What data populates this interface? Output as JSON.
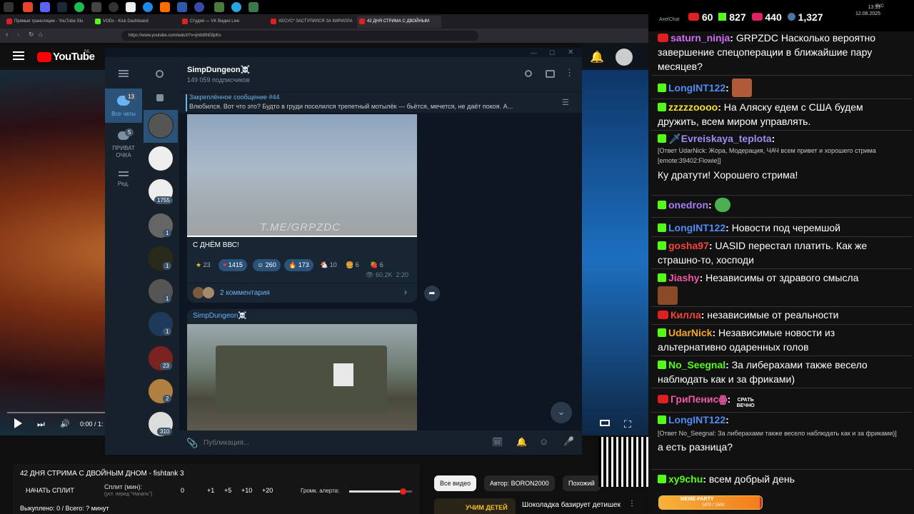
{
  "system": {
    "time": "13:39",
    "date": "12.08.2025",
    "lang": "РУС"
  },
  "browser": {
    "tabs": [
      {
        "label": "Прямые трансляции - YouTube Stu"
      },
      {
        "label": "VODs - Kick Dashboard"
      },
      {
        "label": "Студия — VK Видео Live"
      },
      {
        "label": "ХЕСУС* ЗАСТУПИЛСЯ ЗА КИРИЛЛА"
      },
      {
        "label": "42 ДНЯ СТРИМА С ДВОЙНЫМ"
      }
    ],
    "url": "https://www.youtube.com/watch?v=jmbt9hE8pKs"
  },
  "youtube": {
    "logo": "YouTube",
    "region": "NL",
    "time": "0:00 / 1:",
    "title": "42 ДНЯ СТРИМА С ДВОЙНЫМ ДНОМ - fishtank 3",
    "filter_all": "Все видео",
    "filter_author": "Автор: BORON2000",
    "filter_similar": "Похожий",
    "rec_title": "Шоколадка базирует детишек",
    "rec_thumb_text": "УЧИМ ДЕТЕЙ"
  },
  "split_panel": {
    "start_label": "НАЧАТЬ СПЛИТ",
    "split_label": "Сплит (мин):",
    "split_hint": "(уст. перед \"Начать\")",
    "value": "0",
    "plus1": "+1",
    "plus5": "+5",
    "plus10": "+10",
    "plus20": "+20",
    "alert_label": "Громк. алерта:",
    "alert_volume": 0.85,
    "status": "Выкуплено: 0 / Всего: ? минут"
  },
  "telegram": {
    "folders": [
      {
        "label": "Все чаты",
        "badge": "13"
      },
      {
        "label": "ПРИВАТ ОЧКА",
        "badge": "5"
      },
      {
        "label": "Ред.",
        "badge": ""
      }
    ],
    "chat_badges": [
      "",
      "",
      "1755",
      "1",
      "1",
      "1",
      "1",
      "23",
      "2",
      "310"
    ],
    "channel_name": "SimpDungeon☠️",
    "subscribers": "149 059 подписчиков",
    "pinned_title": "Закреплённое сообщение #44",
    "pinned_text": "Влюбился.   Вот что это? Будто в груди поселился трепетный мотылёк — бьётся, мечется, не даёт покоя. А...",
    "post1": {
      "watermark": "T.ME/GRPZDC",
      "caption": "С ДНЁМ ВВС!",
      "reactions": [
        {
          "icon": "★",
          "count": "23"
        },
        {
          "icon": "♥",
          "count": "1415"
        },
        {
          "icon": "☺",
          "count": "260"
        },
        {
          "icon": "🔥",
          "count": "173"
        },
        {
          "icon": "🐔",
          "count": "10"
        },
        {
          "icon": "🍔",
          "count": "6"
        },
        {
          "icon": "🍓",
          "count": "6"
        }
      ],
      "views": "60.2K",
      "time": "2:20",
      "comments": "2 комментария"
    },
    "post2": {
      "author": "SimpDungeon☠️"
    },
    "input_placeholder": "Публикация..."
  },
  "chat_header": {
    "app": "AxelChat",
    "yt_viewers": "60",
    "kick_viewers": "827",
    "vk_viewers": "440",
    "total_viewers": "1,327"
  },
  "chat_messages": [
    {
      "platform": "yt",
      "user": "saturn_ninja",
      "color": "#d16cf5",
      "text": "GRPZDC Насколько вероятно завершение спецоперации в ближайшие пару месяцев?"
    },
    {
      "platform": "kick",
      "user": "LongINT122",
      "color": "#4f8df6",
      "text": ""
    },
    {
      "platform": "kick",
      "user": "zzzzzoooo",
      "color": "#f5e02c",
      "text": "На Аляску едем с США будем дружить, всем миром управлять."
    },
    {
      "platform": "kick",
      "user": "Evreiskaya_teplota",
      "color": "#9a8cf5",
      "reply": "[Ответ UdarNick: Жора, Модерация, ЧАЧ всем привет и хорошего стрима [emote:39402:Flowie]]",
      "text": "Ку дратути! Хорошего стрима!"
    },
    {
      "platform": "kick",
      "user": "onedron",
      "color": "#a77cf5",
      "text": ""
    },
    {
      "platform": "kick",
      "user": "LongINT122",
      "color": "#4f8df6",
      "text": "Новости под черемшой"
    },
    {
      "platform": "kick",
      "user": "gosha97",
      "color": "#f5443a",
      "text": "UASID перестал платить. Как же страшно-то, хосподи"
    },
    {
      "platform": "kick",
      "user": "Jiashy",
      "color": "#f05aa6",
      "text": "Независимы от здравого смысла"
    },
    {
      "platform": "yt",
      "user": "Килла",
      "color": "#f5443a",
      "text": "независимые от реальности"
    },
    {
      "platform": "kick",
      "user": "UdarNick",
      "color": "#f5a623",
      "text": "Независимые новости из альтернативно одаренных голов"
    },
    {
      "platform": "kick",
      "user": "No_Seegnal",
      "color": "#53fc18",
      "text": "За либерахами также весело наблюдать как и за фриками)"
    },
    {
      "platform": "yt",
      "user": "ГриПенисꙮ",
      "color": "#f05aa6",
      "text": "СРАТЬ ВЕЧНО"
    },
    {
      "platform": "kick",
      "user": "LongINT122",
      "color": "#4f8df6",
      "reply": "[Ответ No_Seegnal: За либерахами также весело наблюдать как и за фриками)]",
      "text": "а есть разница?"
    },
    {
      "platform": "kick",
      "user": "xy9chu",
      "color": "#53fc18",
      "text": "всем добрый день"
    }
  ],
  "meme_bar": {
    "label": "MEME-PARTY",
    "progress_text": "1470 / 1500",
    "progress": 0.98
  }
}
